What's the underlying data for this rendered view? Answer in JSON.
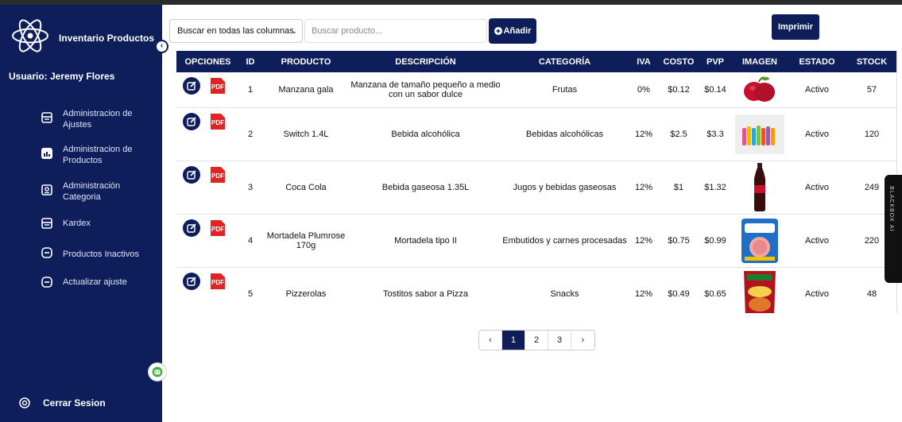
{
  "app": {
    "title": "Inventario Productos",
    "user": "Usuario: Jeremy Flores"
  },
  "sidebar": {
    "items": [
      {
        "label": "Administracion de Ajustes",
        "icon": "receipt-icon"
      },
      {
        "label": "Administracion de Productos",
        "icon": "chart-icon"
      },
      {
        "label": "Administración Categoria",
        "icon": "id-card-icon"
      },
      {
        "label": "Kardex",
        "icon": "receipt-icon"
      },
      {
        "label": "Productos Inactivos",
        "icon": "box-icon"
      },
      {
        "label": "Actualizar ajuste",
        "icon": "box-icon"
      }
    ],
    "logout": "Cerrar Sesion"
  },
  "toolbar": {
    "filter_select": "Buscar en todas las columnas",
    "search_placeholder": "Buscar producto...",
    "add_label": "Añadir",
    "print_label": "Imprimir"
  },
  "table": {
    "headers": [
      "OPCIONES",
      "ID",
      "PRODUCTO",
      "DESCRIPCIÓN",
      "CATEGORÍA",
      "IVA",
      "COSTO",
      "PVP",
      "IMAGEN",
      "ESTADO",
      "STOCK"
    ],
    "pdf_label": "PDF",
    "rows": [
      {
        "id": "1",
        "producto": "Manzana gala",
        "descripcion": "Manzana de tamaño pequeño a medio con un sabor dulce",
        "categoria": "Frutas",
        "iva": "0%",
        "costo": "$0.12",
        "pvp": "$0.14",
        "imagen": "apple-image",
        "estado": "Activo",
        "stock": "57"
      },
      {
        "id": "2",
        "producto": "Switch 1.4L",
        "descripcion": "Bebida alcohólica",
        "categoria": "Bebidas alcohólicas",
        "iva": "12%",
        "costo": "$2.5",
        "pvp": "$3.3",
        "imagen": "bottles-image",
        "estado": "Activo",
        "stock": "120"
      },
      {
        "id": "3",
        "producto": "Coca Cola",
        "descripcion": "Bebida gaseosa 1.35L",
        "categoria": "Jugos y bebidas gaseosas",
        "iva": "12%",
        "costo": "$1",
        "pvp": "$1.32",
        "imagen": "cola-bottle-image",
        "estado": "Activo",
        "stock": "249"
      },
      {
        "id": "4",
        "producto": "Mortadela Plumrose 170g",
        "descripcion": "Mortadela tipo II",
        "categoria": "Embutidos y carnes procesadas",
        "iva": "12%",
        "costo": "$0.75",
        "pvp": "$0.99",
        "imagen": "mortadela-pack-image",
        "estado": "Activo",
        "stock": "220"
      },
      {
        "id": "5",
        "producto": "Pizzerolas",
        "descripcion": "Tostitos sabor a Pizza",
        "categoria": "Snacks",
        "iva": "12%",
        "costo": "$0.49",
        "pvp": "$0.65",
        "imagen": "snack-bag-image",
        "estado": "Activo",
        "stock": "48"
      }
    ]
  },
  "pagination": {
    "prev": "‹",
    "pages": [
      "1",
      "2",
      "3"
    ],
    "next": "›",
    "active": "1"
  },
  "side_widget": {
    "label": "BLACKBOX AI"
  },
  "colors": {
    "navy": "#0e1e5b",
    "pdf_red": "#e02424",
    "white": "#ffffff"
  }
}
